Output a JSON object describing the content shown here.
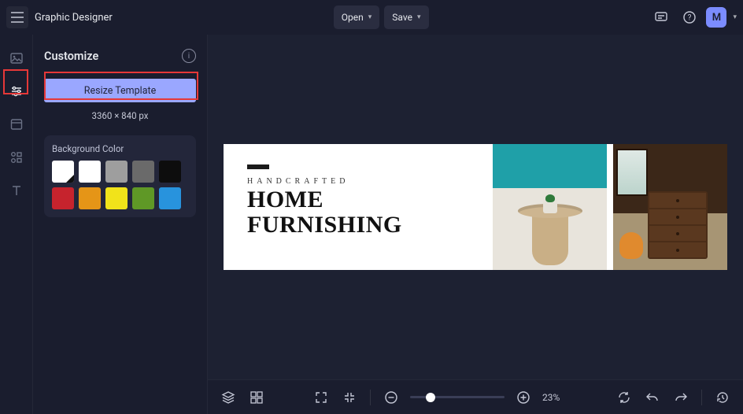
{
  "header": {
    "app_name": "Graphic Designer",
    "open_label": "Open",
    "save_label": "Save",
    "avatar_letter": "M"
  },
  "panel": {
    "title": "Customize",
    "resize_label": "Resize Template",
    "dimensions": "3360 × 840 px",
    "bg_label": "Background Color",
    "swatches": [
      "#ffffff",
      "#9e9e9e",
      "#6a6a6a",
      "#0d0d0d",
      "#c6232d",
      "#e59517",
      "#f1e31a",
      "#5f9826",
      "#2893dd"
    ]
  },
  "design": {
    "tagline": "HANDCRAFTED",
    "headline_1": "HOME",
    "headline_2": "FURNISHING"
  },
  "bottom": {
    "zoom_pct": "23%"
  }
}
